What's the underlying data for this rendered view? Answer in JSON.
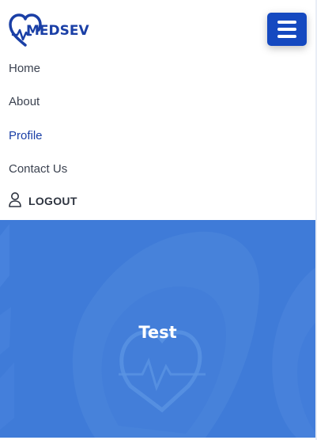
{
  "brand": {
    "name": "MEDSEV",
    "color": "#1a3fa6",
    "logo_icon": "heart-pulse-icon"
  },
  "menu_button": {
    "icon": "hamburger-icon",
    "color": "#1549c0"
  },
  "nav": {
    "items": [
      {
        "label": "Home",
        "active": false
      },
      {
        "label": "About",
        "active": false
      },
      {
        "label": "Profile",
        "active": true
      },
      {
        "label": "Contact Us",
        "active": false
      }
    ]
  },
  "logout": {
    "label": "LOGOUT",
    "icon": "user-icon"
  },
  "hero": {
    "title": "Test",
    "background_color": "#3f7bd8"
  }
}
